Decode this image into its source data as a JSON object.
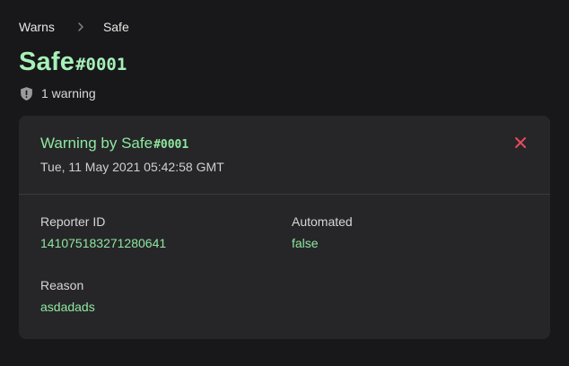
{
  "breadcrumb": {
    "parent": "Warns",
    "current": "Safe"
  },
  "header": {
    "user_name": "Safe",
    "discriminator": "#0001",
    "warning_count_text": "1 warning"
  },
  "warning_card": {
    "title_prefix": "Warning by ",
    "user_name": "Safe",
    "discriminator": "#0001",
    "date": "Tue, 11 May 2021 05:42:58 GMT",
    "fields": {
      "reporter_id_label": "Reporter ID",
      "reporter_id_value": "141075183271280641",
      "automated_label": "Automated",
      "automated_value": "false",
      "reason_label": "Reason",
      "reason_value": "asdadads"
    }
  },
  "icons": {
    "breadcrumb_separator": "chevron-right-icon",
    "warning_count": "shield-alert-icon",
    "close": "close-icon"
  },
  "colors": {
    "background": "#18181a",
    "card": "#262628",
    "accent_green": "#a6f1b8",
    "value_green": "#8ee7a0",
    "close_red": "#e84a5f"
  }
}
